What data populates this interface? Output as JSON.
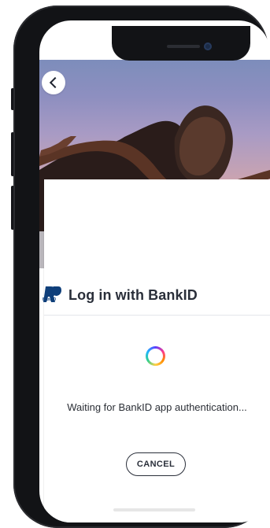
{
  "screen": {
    "title": "Log in with BankID",
    "status": "Waiting for BankID app authentication...",
    "cancel_label": "CANCEL",
    "bankid_logo_text": "BankID"
  },
  "icons": {
    "back": "chevron-left-icon",
    "spinner": "loading-spinner-icon",
    "bankid": "bankid-logo-icon"
  },
  "colors": {
    "text_primary": "#2a2f3a",
    "divider": "#e4e6ea",
    "bankid_blue": "#0f3f7a"
  }
}
